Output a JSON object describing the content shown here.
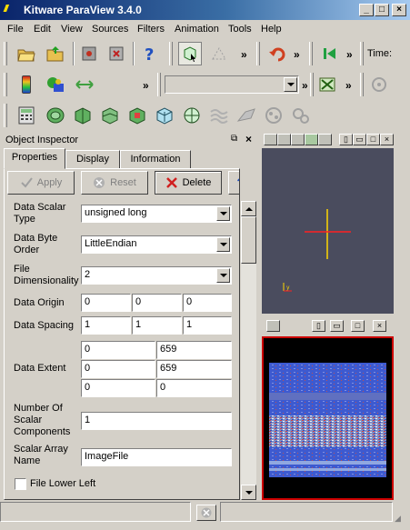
{
  "window": {
    "title": "Kitware ParaView 3.4.0",
    "logo": "///",
    "buttons": [
      "_",
      "□",
      "×"
    ]
  },
  "menu": [
    "File",
    "Edit",
    "View",
    "Sources",
    "Filters",
    "Animation",
    "Tools",
    "Help"
  ],
  "toolbar": {
    "chevron": "»",
    "time_label": "Time:"
  },
  "object_inspector": {
    "title": "Object Inspector",
    "tabs": [
      "Properties",
      "Display",
      "Information"
    ],
    "apply": "Apply",
    "reset": "Reset",
    "delete": "Delete",
    "help": "?"
  },
  "properties": {
    "data_scalar_type": {
      "label": "Data Scalar Type",
      "value": "unsigned long"
    },
    "data_byte_order": {
      "label": "Data Byte Order",
      "value": "LittleEndian"
    },
    "file_dimensionality": {
      "label": "File Dimensionality",
      "value": "2"
    },
    "data_origin": {
      "label": "Data Origin",
      "values": [
        "0",
        "0",
        "0"
      ]
    },
    "data_spacing": {
      "label": "Data Spacing",
      "values": [
        "1",
        "1",
        "1"
      ]
    },
    "data_extent": {
      "label": "Data Extent",
      "values": [
        "0",
        "659",
        "0",
        "659",
        "0",
        "0"
      ]
    },
    "num_scalar_components": {
      "label": "Number Of Scalar Components",
      "value": "1"
    },
    "scalar_array_name": {
      "label": "Scalar Array Name",
      "value": "ImageFile"
    },
    "file_lower_left": {
      "label": "File Lower Left",
      "checked": false
    }
  },
  "colors": {
    "title_start": "#0a246a",
    "active_view_border": "#cc0000",
    "image_blue": "#3d5ad0",
    "axis_yellow": "#ffd700",
    "axis_red": "#ff2020"
  }
}
